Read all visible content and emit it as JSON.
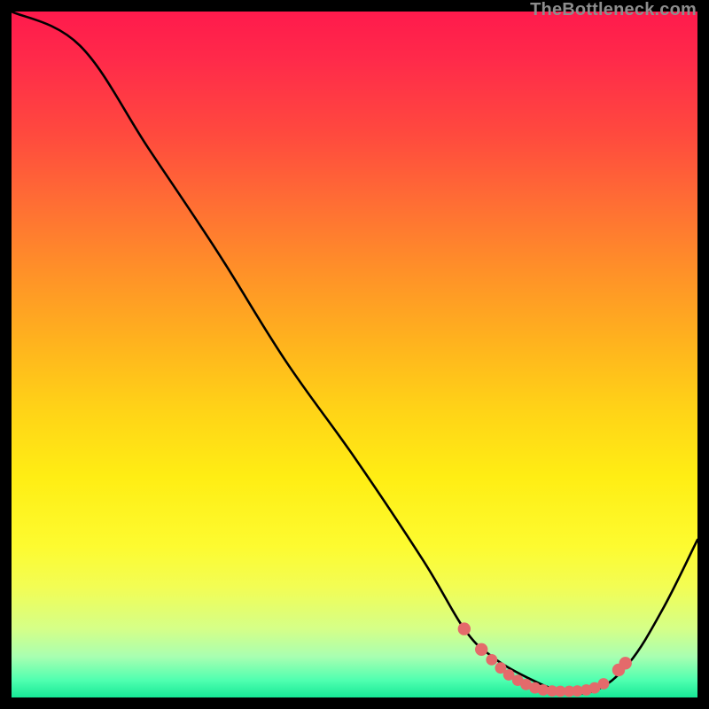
{
  "watermark": "TheBottleneck.com",
  "chart_data": {
    "type": "line",
    "title": "",
    "xlabel": "",
    "ylabel": "",
    "xlim": [
      0,
      100
    ],
    "ylim": [
      0,
      100
    ],
    "series": [
      {
        "name": "curve",
        "x": [
          0,
          10,
          20,
          30,
          40,
          50,
          60,
          66,
          70,
          75,
          80,
          85,
          90,
          95,
          100
        ],
        "y": [
          100,
          95,
          80,
          65,
          49,
          35,
          20,
          10,
          6,
          3,
          1,
          1,
          5,
          13,
          23
        ]
      }
    ],
    "markers": {
      "name": "dots",
      "color": "#e46a6b",
      "points": [
        {
          "x": 66.0,
          "y": 10.0
        },
        {
          "x": 68.5,
          "y": 7.0
        },
        {
          "x": 70.0,
          "y": 5.5
        },
        {
          "x": 71.3,
          "y": 4.3
        },
        {
          "x": 72.5,
          "y": 3.3
        },
        {
          "x": 73.8,
          "y": 2.5
        },
        {
          "x": 75.0,
          "y": 1.9
        },
        {
          "x": 76.3,
          "y": 1.4
        },
        {
          "x": 77.5,
          "y": 1.1
        },
        {
          "x": 78.8,
          "y": 0.95
        },
        {
          "x": 80.0,
          "y": 0.9
        },
        {
          "x": 81.3,
          "y": 0.9
        },
        {
          "x": 82.5,
          "y": 0.95
        },
        {
          "x": 83.8,
          "y": 1.1
        },
        {
          "x": 85.0,
          "y": 1.4
        },
        {
          "x": 86.3,
          "y": 2.0
        },
        {
          "x": 88.5,
          "y": 4.0
        },
        {
          "x": 89.5,
          "y": 5.0
        }
      ]
    }
  }
}
